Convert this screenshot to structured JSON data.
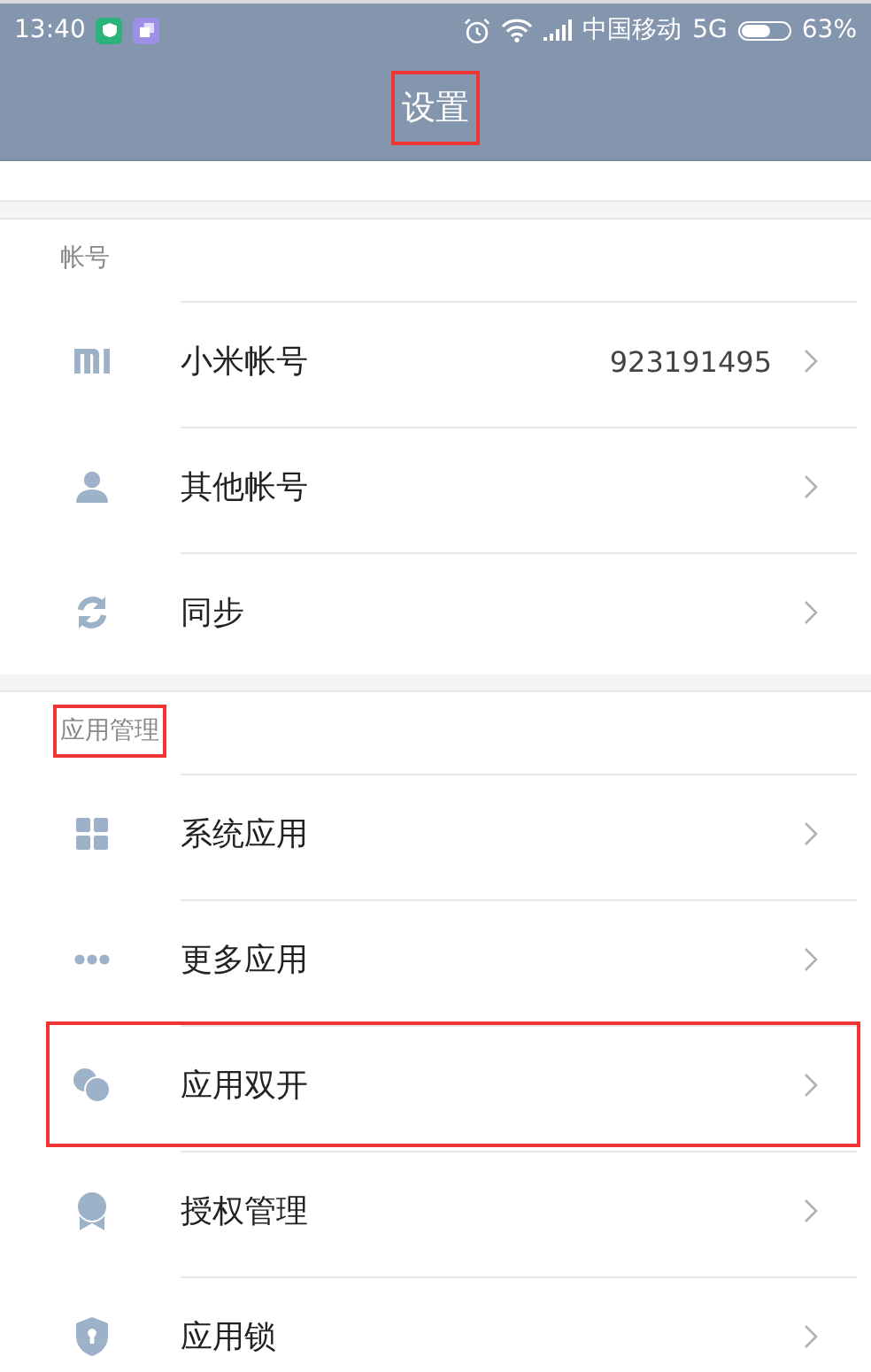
{
  "status_bar": {
    "time": "13:40",
    "carrier": "中国移动",
    "network": "5G",
    "battery_percent": "63%"
  },
  "header": {
    "title": "设置",
    "highlighted": true
  },
  "sections": [
    {
      "title": "帐号",
      "highlighted": false,
      "items": [
        {
          "kind": "mi",
          "label": "小米帐号",
          "value": "923191495",
          "highlighted": false
        },
        {
          "kind": "person",
          "label": "其他帐号",
          "highlighted": false
        },
        {
          "kind": "sync",
          "label": "同步",
          "highlighted": false
        }
      ]
    },
    {
      "title": "应用管理",
      "highlighted": true,
      "items": [
        {
          "kind": "grid",
          "label": "系统应用",
          "highlighted": false
        },
        {
          "kind": "dots",
          "label": "更多应用",
          "highlighted": false
        },
        {
          "kind": "circles",
          "label": "应用双开",
          "highlighted": true
        },
        {
          "kind": "badge",
          "label": "授权管理",
          "highlighted": false
        },
        {
          "kind": "shield",
          "label": "应用锁",
          "highlighted": false
        }
      ]
    }
  ]
}
